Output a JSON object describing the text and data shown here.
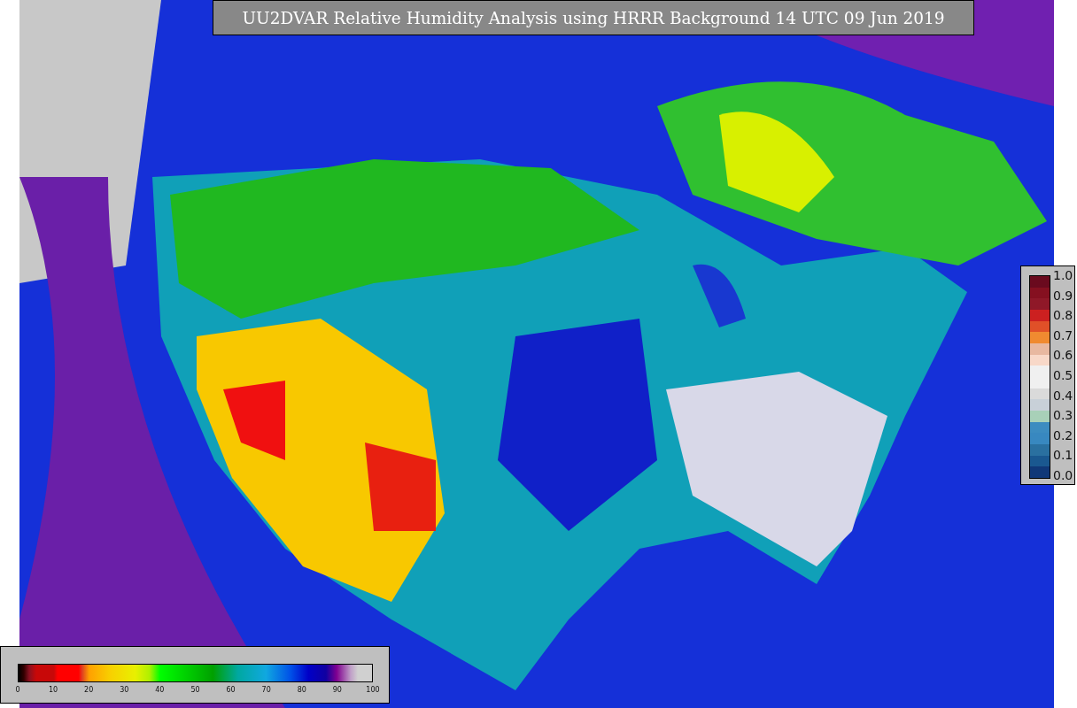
{
  "title": "UU2DVAR Relative Humidity Analysis using HRRR Background 14 UTC 09 Jun 2019",
  "ratio_legend": {
    "labels": [
      "1.0",
      "0.9",
      "0.8",
      "0.7",
      "0.6",
      "0.5",
      "0.4",
      "0.3",
      "0.2",
      "0.1",
      "0.0"
    ]
  },
  "humidity_legend": {
    "labels": [
      "0",
      "10",
      "20",
      "30",
      "40",
      "50",
      "60",
      "70",
      "80",
      "90",
      "100"
    ]
  }
}
